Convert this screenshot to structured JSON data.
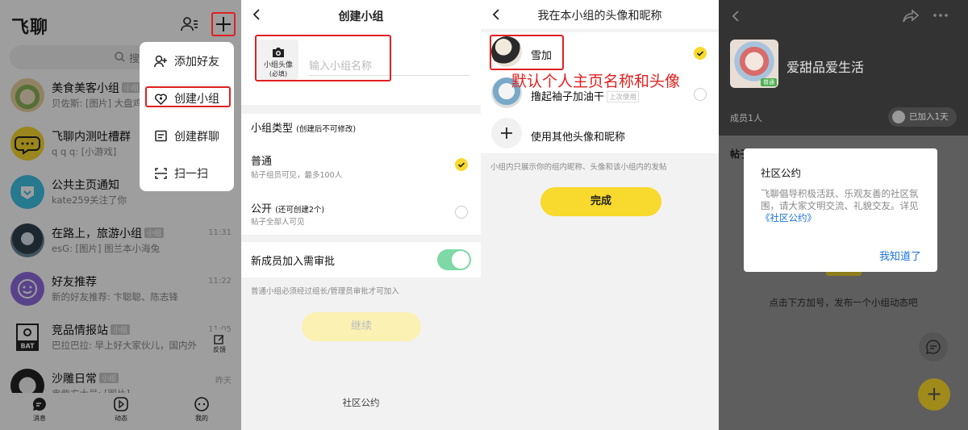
{
  "panel1": {
    "title": "飞聊",
    "search_placeholder": "搜索",
    "chats": [
      {
        "name": "美食美客小组",
        "tag": "小组",
        "msg": "贝佐斯: [图片] 大盘鸡",
        "time": ""
      },
      {
        "name": "飞聊内测吐槽群",
        "tag": "",
        "msg": "q q q: [小游戏]",
        "time": ""
      },
      {
        "name": "公共主页通知",
        "tag": "",
        "msg": "kate259关注了你",
        "time": ""
      },
      {
        "name": "在路上，旅游小组",
        "tag": "小组",
        "msg": "esG: [图片] 图兰本小海兔",
        "time": "11:31"
      },
      {
        "name": "好友推荐",
        "tag": "",
        "msg": "新的好友推荐: 卞聪聪、陈志锋",
        "time": "11:22"
      },
      {
        "name": "竞品情报站",
        "tag": "小组",
        "msg": "巴拉巴拉: 早上好大家伙儿，国内外",
        "time": "11:05"
      },
      {
        "name": "沙雕日常",
        "tag": "小组",
        "msg": "串紫方大号: [图片]",
        "time": "昨天"
      }
    ],
    "menu": [
      "添加好友",
      "创建小组",
      "创建群聊",
      "扫一扫"
    ],
    "float_label": "反馈",
    "tabs": [
      "消息",
      "动态",
      "我的"
    ]
  },
  "panel2": {
    "title": "创建小组",
    "photo_label": "小组头像",
    "photo_sub": "(必填)",
    "name_placeholder": "输入小组名称",
    "type_label": "小组类型",
    "type_note": "(创建后不可修改)",
    "option1": "普通",
    "option1_desc": "帖子组员可见，最多100人",
    "option2": "公开",
    "option2_note": "(还可创建2个)",
    "option2_desc": "帖子全部人可见",
    "approval_label": "新成员加入需审批",
    "approval_note": "普通小组必须经过组长/管理员审批才可加入",
    "continue": "继续",
    "footer": "社区公约"
  },
  "panel3": {
    "title": "我在本小组的头像和昵称",
    "row1": "雪加",
    "row2": "撸起袖子加油干",
    "row2_tag": "上次使用",
    "row3": "使用其他头像和昵称",
    "note": "小组内只展示你的组内昵称、头像和该小组内的发帖",
    "done": "完成",
    "annotation": "默认个人主页名称和头像"
  },
  "panel4": {
    "group_name": "爱甜品爱生活",
    "badge": "普通",
    "members": "成员1人",
    "joined": "已加入1天",
    "posts_label": "帖子",
    "body_text": "点击下方加号，发布一个小组动态吧",
    "dialog_title": "社区公约",
    "dialog_body": "飞聊倡导积极活跃、乐观友善的社区氛围，请大家文明交流、礼貌交友。详见",
    "dialog_link": "《社区公约》",
    "dialog_ok": "我知道了",
    "fab": "+"
  }
}
